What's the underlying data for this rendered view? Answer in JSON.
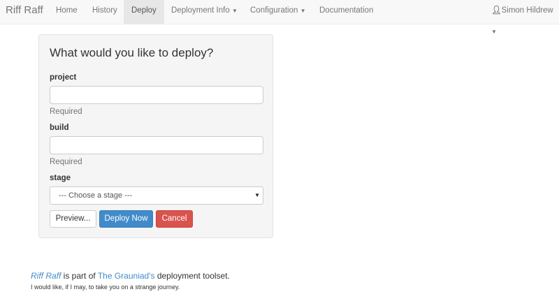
{
  "nav": {
    "brand": "Riff Raff",
    "items": [
      "Home",
      "History",
      "Deploy",
      "Deployment Info",
      "Configuration",
      "Documentation"
    ],
    "user": "Simon Hildrew"
  },
  "form": {
    "title": "What would you like to deploy?",
    "project_label": "project",
    "project_value": "",
    "project_help": "Required",
    "build_label": "build",
    "build_value": "",
    "build_help": "Required",
    "stage_label": "stage",
    "stage_selected": "--- Choose a stage ---",
    "preview": "Preview...",
    "deploy": "Deploy Now",
    "cancel": "Cancel"
  },
  "footer": {
    "app": "Riff Raff",
    "mid": " is part of ",
    "org": "The Grauniad's",
    "end": " deployment toolset.",
    "tagline": "I would like, if I may, to take you on a strange journey."
  },
  "colors": {
    "primary": "#428bca",
    "danger": "#d9534f"
  }
}
